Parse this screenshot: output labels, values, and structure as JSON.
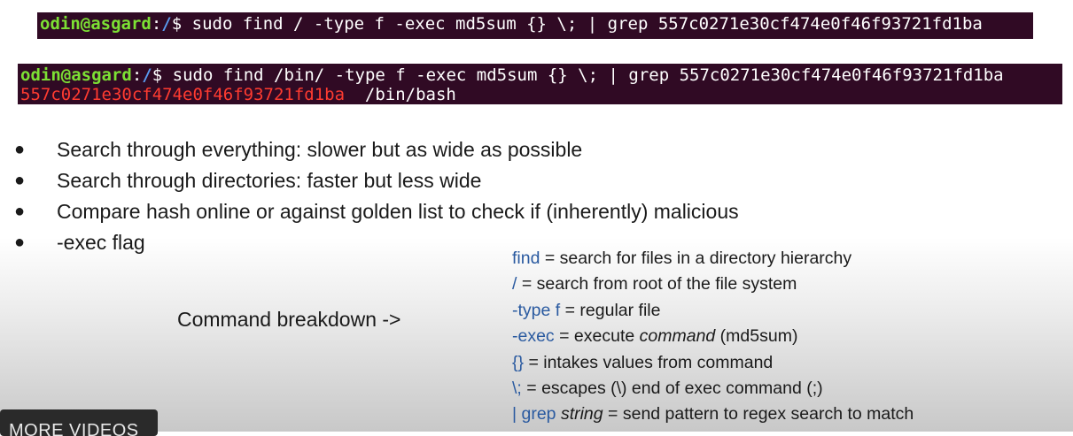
{
  "terminal1": {
    "user": "odin@asgard",
    "sep": ":",
    "path": "/",
    "command": "$ sudo find / -type f -exec md5sum {} \\; | grep 557c0271e30cf474e0f46f93721fd1ba"
  },
  "terminal2": {
    "user": "odin@asgard",
    "sep": ":",
    "path": "/",
    "command": "$ sudo find /bin/ -type f -exec md5sum {} \\; | grep 557c0271e30cf474e0f46f93721fd1ba",
    "result_hash": "557c0271e30cf474e0f46f93721fd1ba",
    "result_file": "  /bin/bash"
  },
  "bullets": [
    "Search through everything: slower but as wide as possible",
    "Search through directories: faster but less wide",
    "Compare hash online or against golden list to check if (inherently) malicious",
    "-exec flag"
  ],
  "bullet_symbol": "●",
  "breakdown_label": "Command breakdown ->",
  "definitions": [
    {
      "kw": "find",
      "rest": " = search for files in a directory hierarchy"
    },
    {
      "kw": "/",
      "rest": " = search from root of the file system"
    },
    {
      "kw": "-type f",
      "rest": " = regular file"
    },
    {
      "kw": "-exec",
      "rest": " = execute ",
      "ital": "command",
      "rest2": " (md5sum)"
    },
    {
      "kw": "{}",
      "rest": " = intakes values from command"
    },
    {
      "kw": "\\;",
      "rest": " = escapes (\\) end of exec command (;)"
    },
    {
      "kw": "| grep",
      "rest": " ",
      "ital": "string",
      "rest2": " = send pattern to regex search to match"
    }
  ],
  "more_videos_label": "MORE VIDEOS",
  "colors": {
    "terminal_bg": "#300a24",
    "user": "#7ce034",
    "path": "#5a9cf0",
    "hash_match": "#ff3b30",
    "keyword": "#2a5aa0"
  }
}
